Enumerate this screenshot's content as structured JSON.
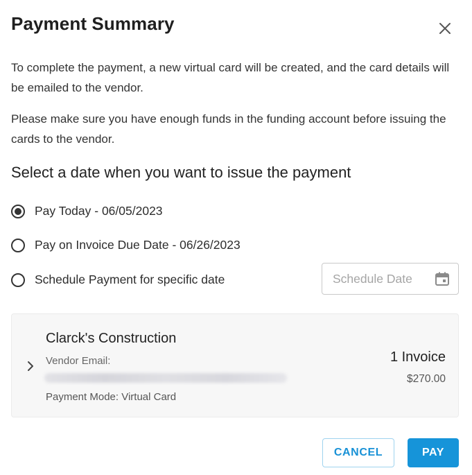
{
  "dialog": {
    "title": "Payment Summary",
    "close_icon": "close-icon"
  },
  "info": {
    "paragraph_1": "To complete the payment, a new virtual card will be created, and the card details will be emailed to the vendor.",
    "paragraph_2": "Please make sure you have enough funds in the funding account before issuing the cards to the vendor."
  },
  "date_selection": {
    "heading": "Select a date when you want to issue the payment",
    "options": [
      {
        "label": "Pay Today - 06/05/2023",
        "selected": true
      },
      {
        "label": "Pay on Invoice Due Date - 06/26/2023",
        "selected": false
      },
      {
        "label": "Schedule Payment for specific date",
        "selected": false
      }
    ],
    "schedule_date": {
      "placeholder": "Schedule Date",
      "value": "",
      "icon": "calendar-icon"
    }
  },
  "vendor": {
    "name": "Clarck's Construction",
    "email_label": "Vendor Email:",
    "payment_mode": "Payment Mode: Virtual Card",
    "invoice_count": "1 Invoice",
    "amount": "$270.00",
    "expand_icon": "chevron-right-icon"
  },
  "actions": {
    "cancel_label": "CANCEL",
    "pay_label": "PAY"
  },
  "colors": {
    "accent": "#1694d9",
    "cancel_border": "#9fd3ef",
    "card_background": "#f7f7f7"
  }
}
